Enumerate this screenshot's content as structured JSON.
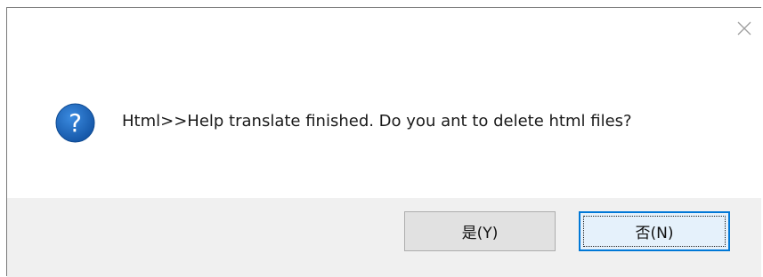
{
  "dialog": {
    "message": "Html>>Help translate finished. Do you ant to delete html files?",
    "icon": "question-icon",
    "close_icon": "close-icon"
  },
  "buttons": {
    "yes_label": "是(Y)",
    "no_label": "否(N)"
  },
  "colors": {
    "icon_blue": "#1a6fc4",
    "focus_border": "#0078d7",
    "footer_bg": "#f0f0f0",
    "button_bg": "#e1e1e1"
  }
}
